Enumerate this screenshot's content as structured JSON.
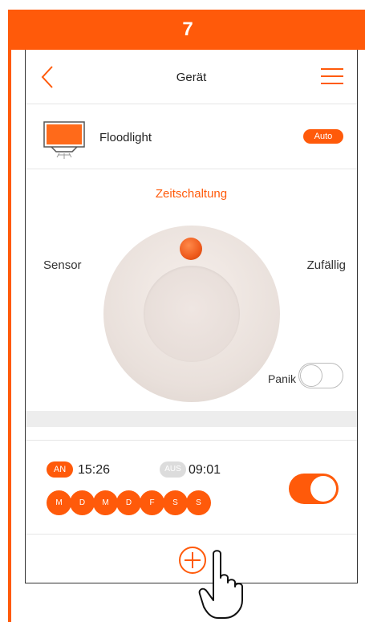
{
  "step": {
    "number": "7"
  },
  "header": {
    "title": "Gerät",
    "back_icon": "chevron-left-icon",
    "menu_icon": "hamburger-menu-icon"
  },
  "device": {
    "icon": "floodlight-icon",
    "name": "Floodlight",
    "mode_badge": "Auto"
  },
  "modes": {
    "timer": "Zeitschaltung",
    "sensor": "Sensor",
    "random": "Zufällig",
    "active": "Zeitschaltung"
  },
  "panic": {
    "label": "Panik",
    "enabled": false
  },
  "schedule": {
    "on_badge": "AN",
    "on_time": "15:26",
    "off_badge": "AUS",
    "off_time": "09:01",
    "days": [
      "M",
      "D",
      "M",
      "D",
      "F",
      "S",
      "S"
    ],
    "enabled": true
  },
  "add": {
    "icon": "plus-circle-icon"
  },
  "colors": {
    "accent": "#ff5a0a",
    "inactive": "#dcdcdc"
  }
}
